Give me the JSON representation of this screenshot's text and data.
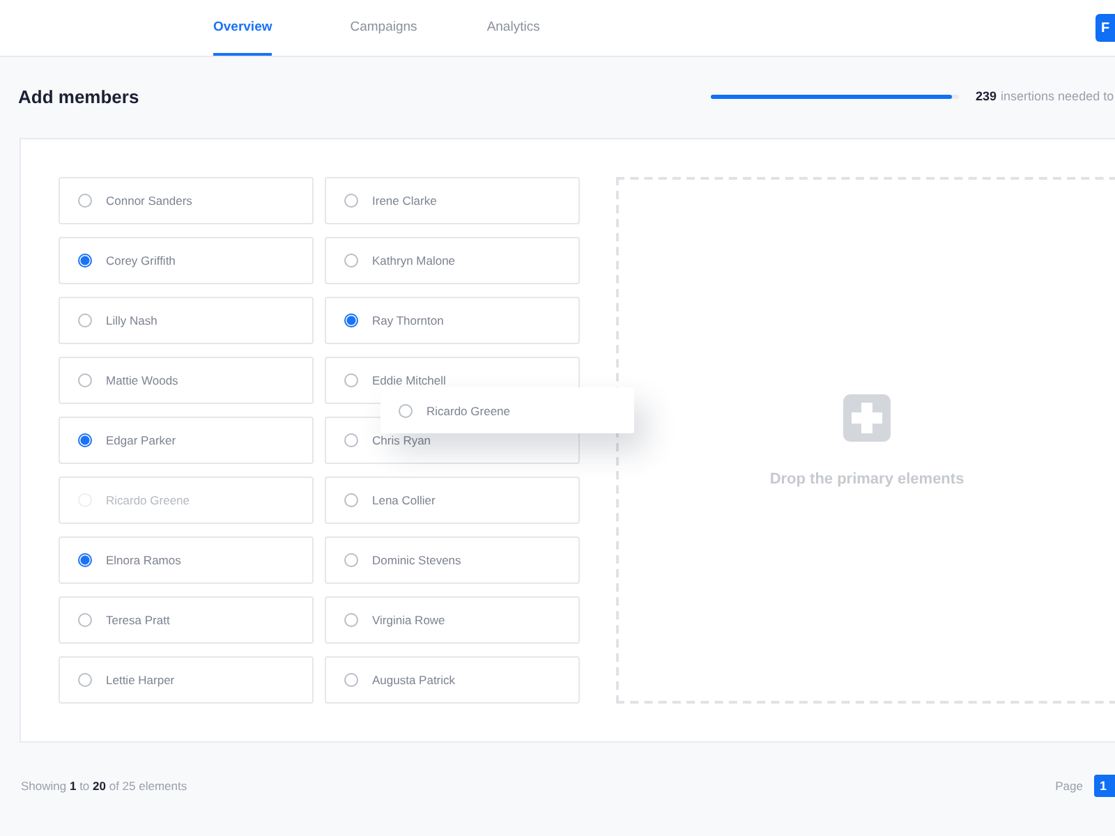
{
  "tabs": [
    {
      "label": "Overview",
      "selected": true
    },
    {
      "label": "Campaigns",
      "selected": false
    },
    {
      "label": "Analytics",
      "selected": false
    }
  ],
  "header_button": "F",
  "title": "Add members",
  "progress": {
    "level": 0.97,
    "count": "239",
    "text": "insertions needed to"
  },
  "members": [
    {
      "name": "Connor Sanders",
      "selected": false,
      "disabled": false
    },
    {
      "name": "Corey Griffith",
      "selected": true,
      "disabled": false
    },
    {
      "name": "Lilly Nash",
      "selected": false,
      "disabled": false
    },
    {
      "name": "Mattie Woods",
      "selected": false,
      "disabled": false
    },
    {
      "name": "Edgar Parker",
      "selected": true,
      "disabled": false
    },
    {
      "name": "Ricardo Greene",
      "selected": false,
      "disabled": true
    },
    {
      "name": "Elnora Ramos",
      "selected": true,
      "disabled": false
    },
    {
      "name": "Teresa Pratt",
      "selected": false,
      "disabled": false
    },
    {
      "name": "Lettie Harper",
      "selected": false,
      "disabled": false
    },
    {
      "name": "Irene Clarke",
      "selected": false,
      "disabled": false
    },
    {
      "name": "Kathryn Malone",
      "selected": false,
      "disabled": false
    },
    {
      "name": "Ray Thornton",
      "selected": true,
      "disabled": false
    },
    {
      "name": "Eddie Mitchell",
      "selected": false,
      "disabled": false
    },
    {
      "name": "Chris Ryan",
      "selected": false,
      "disabled": false
    },
    {
      "name": "Lena Collier",
      "selected": false,
      "disabled": false
    },
    {
      "name": "Dominic Stevens",
      "selected": false,
      "disabled": false
    },
    {
      "name": "Virginia Rowe",
      "selected": false,
      "disabled": false
    },
    {
      "name": "Augusta Patrick",
      "selected": false,
      "disabled": false
    }
  ],
  "dragged": {
    "name": "Ricardo Greene",
    "selected": false
  },
  "drop_zone": {
    "label": "Drop the primary elements"
  },
  "footer": {
    "summary": "Showing **1** to **20** of 25 elements",
    "page_label": "Page",
    "page": "1"
  }
}
